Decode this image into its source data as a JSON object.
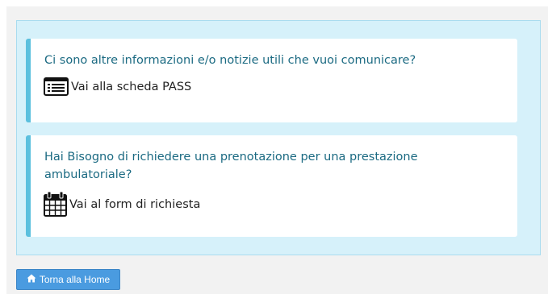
{
  "cards": [
    {
      "question": "Ci sono altre informazioni e/o notizie utili che vuoi comunicare?",
      "link_label": "Vai alla scheda PASS",
      "icon": "list-alt-icon"
    },
    {
      "question": "Hai Bisogno di richiedere una prenotazione per una prestazione ambulatoriale?",
      "link_label": "Vai al form di richiesta",
      "icon": "calendar-icon"
    }
  ],
  "home_button": {
    "label": "Torna alla Home",
    "icon": "home-icon"
  },
  "colors": {
    "panel_background": "#d6f1fa",
    "card_accent": "#5bc0de",
    "question_text": "#1b6a82",
    "button_background": "#4a9be0"
  }
}
